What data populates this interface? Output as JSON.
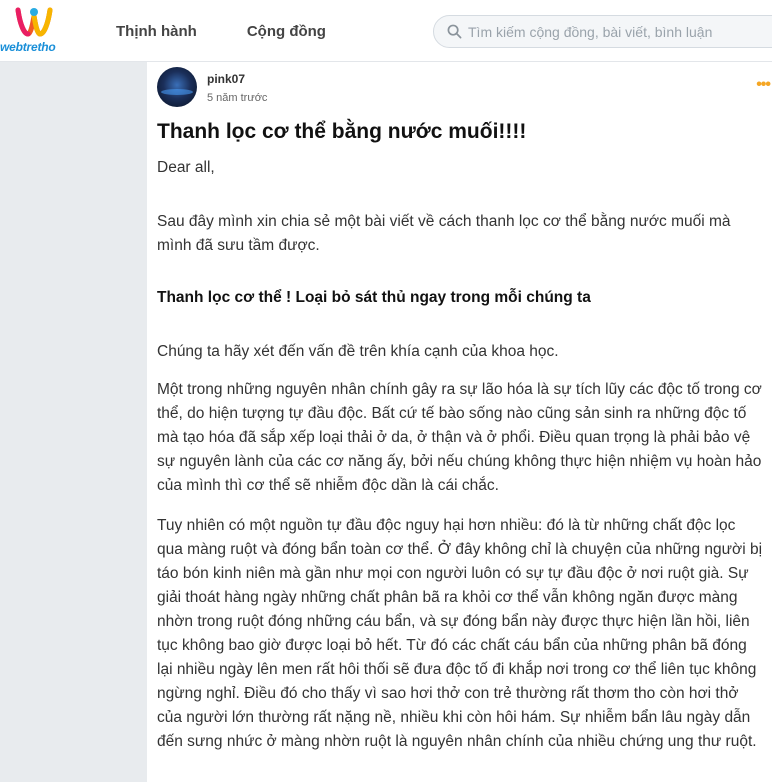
{
  "header": {
    "logo_text": "webtretho",
    "nav": [
      "Thịnh hành",
      "Cộng đồng"
    ],
    "search_placeholder": "Tìm kiếm cộng đồng, bài viết, bình luận"
  },
  "post": {
    "author": "pink07",
    "time": "5 năm trước",
    "more_label": "•••",
    "title": "Thanh lọc cơ thể bằng nước muối!!!!",
    "paragraphs": {
      "greeting": "Dear all,",
      "intro": "Sau đây mình xin chia sẻ một bài viết về cách thanh lọc cơ thể bằng nước muối mà mình đã sưu tầm được.",
      "subheading": "Thanh lọc cơ thể ! Loại bỏ sát thủ ngay trong mỗi chúng ta",
      "science": "Chúng ta hãy xét đến vấn đề trên khía cạnh của khoa học.",
      "p1": "Một trong những nguyên nhân chính gây ra sự lão hóa là sự tích lũy các độc tố trong cơ thể, do hiện tượng tự đầu độc. Bất cứ tế bào sống nào cũng sản sinh ra những độc tố mà tạo hóa đã sắp xếp loại thải ở da, ở thận và ở phổi. Điều quan trọng là phải bảo vệ sự nguyên lành của các cơ năng ấy, bởi nếu chúng không thực hiện nhiệm vụ hoàn hảo của mình thì cơ thể sẽ nhiễm độc dần là cái chắc.",
      "p2": "Tuy nhiên có một nguồn tự đầu độc nguy hại hơn nhiều: đó là từ những chất độc lọc qua màng ruột và đóng bẩn toàn cơ thể. Ở đây không chỉ là chuyện của những người bị táo bón kinh niên mà gần như mọi con người luôn có sự tự đầu độc ở nơi ruột già. Sự giải thoát hàng ngày những chất phân bã ra khỏi cơ thể vẫn không ngăn được màng nhờn trong ruột đóng những cáu bẩn, và sự đóng bẩn này được thực hiện lần hồi, liên tục không bao giờ được loại bỏ hết. Từ đó các chất cáu bẩn của những phân bã đóng lại nhiều ngày lên men rất hôi thối sẽ đưa độc tố đi khắp nơi trong cơ thể liên tục không ngừng nghỉ. Điều đó cho thấy vì sao hơi thở con trẻ thường rất thơm tho còn hơi thở của người lớn thường rất nặng nề, nhiều khi còn hôi hám. Sự nhiễm bẩn lâu ngày dẫn đến sưng nhức ở màng nhờn ruột là nguyên nhân chính của nhiều chứng ung thư ruột."
    }
  },
  "colors": {
    "logo_blue": "#1a8fd8",
    "more_orange": "#f5a623",
    "sidebar_gray": "#e8ebee"
  }
}
